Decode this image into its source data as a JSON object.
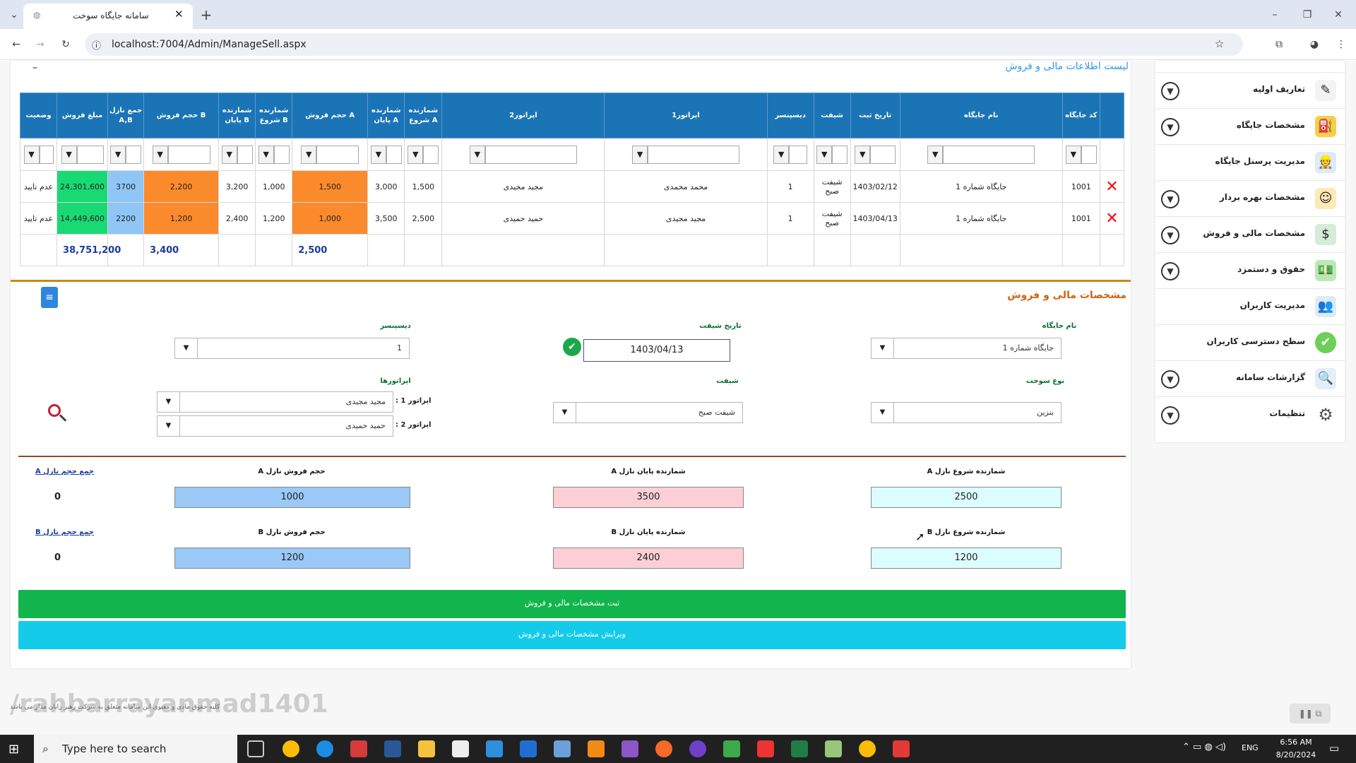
{
  "browser": {
    "tab_title": "سامانه جایگاه سوخت",
    "url": "localhost:7004/Admin/ManageSell.aspx"
  },
  "sidebar": {
    "items": [
      {
        "label": "تعاریف اولیه",
        "icon": "pencil-icon",
        "chevron": true
      },
      {
        "label": "مشخصات جایگاه",
        "icon": "station-icon",
        "chevron": true
      },
      {
        "label": "مدیریت پرسنل جایگاه",
        "icon": "worker-icon",
        "chevron": false
      },
      {
        "label": "مشخصات بهره بردار",
        "icon": "operator-icon",
        "chevron": true
      },
      {
        "label": "مشخصات مالی و فروش",
        "icon": "money-icon",
        "chevron": true
      },
      {
        "label": "حقوق و دستمزد",
        "icon": "salary-icon",
        "chevron": true
      },
      {
        "label": "مدیریت کاربران",
        "icon": "users-icon",
        "chevron": false
      },
      {
        "label": "سطح دسترسی کاربران",
        "icon": "check-icon",
        "chevron": false
      },
      {
        "label": "گزارشات سامانه",
        "icon": "report-icon",
        "chevron": true
      },
      {
        "label": "تنظیمات",
        "icon": "gear-icon",
        "chevron": true
      }
    ]
  },
  "list": {
    "title": "لیست اطلاعات مالی و فروش",
    "columns": [
      "کد جایگاه",
      "نام جایگاه",
      "تاریخ ثبت",
      "شیفت",
      "دیسپنسر",
      "اپراتور1",
      "اپراتور2",
      "شمارنده شروع A",
      "شمارنده پایان A",
      "حجم فروش A",
      "شمارنده شروع B",
      "شمارنده پایان B",
      "حجم فروش B",
      "جمع نازل A,B",
      "مبلغ فروش",
      "وضعیت"
    ],
    "rows": [
      {
        "code": "1001",
        "station": "جایگاه شماره 1",
        "date": "1403/02/12",
        "shift": "شیفت صبح",
        "dispenser": "1",
        "op1": "محمد محمدی",
        "op2": "مجید مجیدی",
        "startA": "1,500",
        "endA": "3,000",
        "volA": "1,500",
        "startB": "1,000",
        "endB": "3,200",
        "volB": "2,200",
        "sumAB": "3700",
        "amount": "24,301,600",
        "status": "عدم تایید"
      },
      {
        "code": "1001",
        "station": "جایگاه شماره 1",
        "date": "1403/04/13",
        "shift": "شیفت صبح",
        "dispenser": "1",
        "op1": "مجید مجیدی",
        "op2": "حمید حمیدی",
        "startA": "2,500",
        "endA": "3,500",
        "volA": "1,000",
        "startB": "1,200",
        "endB": "2,400",
        "volB": "1,200",
        "sumAB": "2200",
        "amount": "14,449,600",
        "status": "عدم تایید"
      }
    ],
    "totals": {
      "volA": "2,500",
      "volB": "3,400",
      "amount": "38,751,200"
    }
  },
  "form": {
    "title": "مشخصات مالی و فروش",
    "station_label": "نام جایگاه",
    "station_value": "جایگاه شماره 1",
    "date_label": "تاریخ شیفت",
    "date_value": "1403/04/13",
    "dispenser_label": "دیسپنسر",
    "dispenser_value": "1",
    "fuel_label": "نوع سوخت",
    "fuel_value": "بنزین",
    "shift_label": "شیفت",
    "shift_value": "شیفت صبح",
    "operators_label": "اپراتورها",
    "op1_label": "اپراتور 1 :",
    "op1_value": "مجید مجیدی",
    "op2_label": "اپراتور 2 :",
    "op2_value": "حمید حمیدی",
    "startA_label": "شمارنده شروع نازل A",
    "startA_value": "2500",
    "endA_label": "شمارنده پایان نازل A",
    "endA_value": "3500",
    "volA_label": "حجم فروش نازل A",
    "volA_value": "1000",
    "sumA_label": "جمع حجم نازل A",
    "sumA_value": "0",
    "startB_label": "شمارنده شروع نازل B",
    "startB_value": "1200",
    "endB_label": "شمارنده پایان نازل B",
    "endB_value": "2400",
    "volB_label": "حجم فروش نازل B",
    "volB_value": "1200",
    "sumB_label": "جمع حجم نازل B",
    "sumB_value": "0",
    "submit_label": "ثبت مشخصات مالی و فروش",
    "edit_label": "ویرایش مشخصات مالی و فروش"
  },
  "watermark": "/rahbarrayanmad1401",
  "footer_text": "کلیه حقوق مادی و معنوی این سامانه متعلق به شرکت رهبر رایان مدار می باشد",
  "taskbar": {
    "search_placeholder": "Type here to search",
    "lang": "ENG",
    "time": "6:56 AM",
    "date": "8/20/2024"
  },
  "colors": {
    "header_blue": "#1b74b5",
    "orange": "#fb8a2d",
    "green": "#19d974",
    "light_blue": "#8fc6f5",
    "submit_green": "#12b54d",
    "edit_cyan": "#14cbea"
  }
}
